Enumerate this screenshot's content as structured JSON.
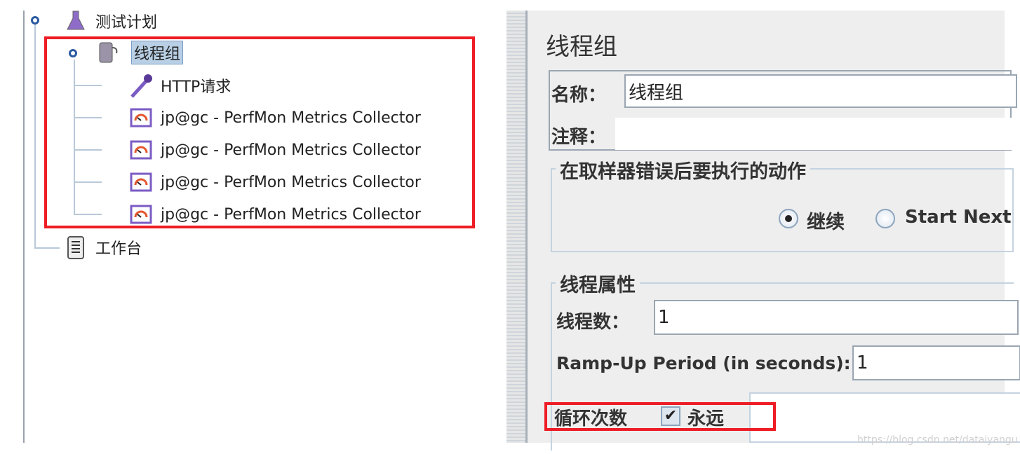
{
  "tree": {
    "test_plan": "测试计划",
    "thread_group": "线程组",
    "http_request": "HTTP请求",
    "collectors": [
      "jp@gc - PerfMon Metrics Collector",
      "jp@gc - PerfMon Metrics Collector",
      "jp@gc - PerfMon Metrics Collector",
      "jp@gc - PerfMon Metrics Collector"
    ],
    "workbench": "工作台"
  },
  "panel": {
    "title": "线程组",
    "name_label": "名称：",
    "name_value": "线程组",
    "comment_label": "注释：",
    "comment_value": "",
    "error_action": {
      "legend": "在取样器错误后要执行的动作",
      "options": [
        {
          "label": "继续",
          "selected": true
        },
        {
          "label": "Start Next",
          "selected": false
        }
      ]
    },
    "thread_props": {
      "legend": "线程属性",
      "threads_label": "线程数：",
      "threads_value": "1",
      "rampup_label": "Ramp-Up Period (in seconds):",
      "rampup_value": "1",
      "loop_label": "循环次数",
      "forever_label": "永远",
      "forever_checked": true,
      "loop_value": ""
    }
  },
  "watermark": "https://blog.csdn.net/dataiyangu",
  "colors": {
    "highlight": "#ee1c24",
    "selection": "#b8cfe5",
    "panel_bg": "#eeeeee"
  }
}
